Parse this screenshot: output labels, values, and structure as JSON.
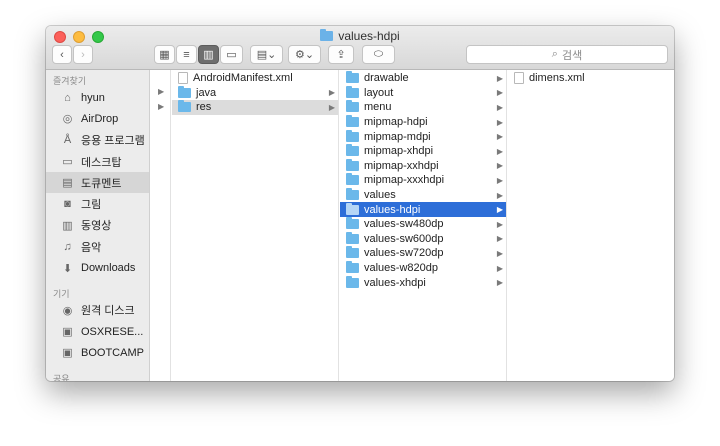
{
  "window": {
    "title": "values-hdpi"
  },
  "search": {
    "placeholder": "검색",
    "icon": "search-icon"
  },
  "sidebar": {
    "favorites_header": "즐겨찾기",
    "favorites": [
      {
        "label": "hyun",
        "icon": "home-icon"
      },
      {
        "label": "AirDrop",
        "icon": "airdrop-icon"
      },
      {
        "label": "응용 프로그램",
        "icon": "applications-icon"
      },
      {
        "label": "데스크탑",
        "icon": "desktop-icon"
      },
      {
        "label": "도큐멘트",
        "icon": "documents-icon"
      },
      {
        "label": "그림",
        "icon": "camera-icon"
      },
      {
        "label": "동영상",
        "icon": "movies-icon"
      },
      {
        "label": "음악",
        "icon": "music-icon"
      },
      {
        "label": "Downloads",
        "icon": "downloads-icon"
      }
    ],
    "devices_header": "기기",
    "devices": [
      {
        "label": "원격 디스크",
        "icon": "disc-icon"
      },
      {
        "label": "OSXRESE...",
        "icon": "drive-icon"
      },
      {
        "label": "BOOTCAMP",
        "icon": "drive-icon"
      }
    ],
    "shared_header": "공유"
  },
  "columns": {
    "col1": [
      {
        "label": "AndroidManifest.xml",
        "type": "file"
      },
      {
        "label": "java",
        "type": "folder"
      },
      {
        "label": "res",
        "type": "folder",
        "selected": true
      }
    ],
    "col2": [
      {
        "label": "drawable"
      },
      {
        "label": "layout"
      },
      {
        "label": "menu"
      },
      {
        "label": "mipmap-hdpi"
      },
      {
        "label": "mipmap-mdpi"
      },
      {
        "label": "mipmap-xhdpi"
      },
      {
        "label": "mipmap-xxhdpi"
      },
      {
        "label": "mipmap-xxxhdpi"
      },
      {
        "label": "values"
      },
      {
        "label": "values-hdpi",
        "active": true
      },
      {
        "label": "values-sw480dp"
      },
      {
        "label": "values-sw600dp"
      },
      {
        "label": "values-sw720dp"
      },
      {
        "label": "values-w820dp"
      },
      {
        "label": "values-xhdpi"
      }
    ],
    "col3": [
      {
        "label": "dimens.xml",
        "type": "file"
      }
    ]
  },
  "colors": {
    "selection": "#2d6ed8",
    "folder": "#6bb8ea"
  }
}
